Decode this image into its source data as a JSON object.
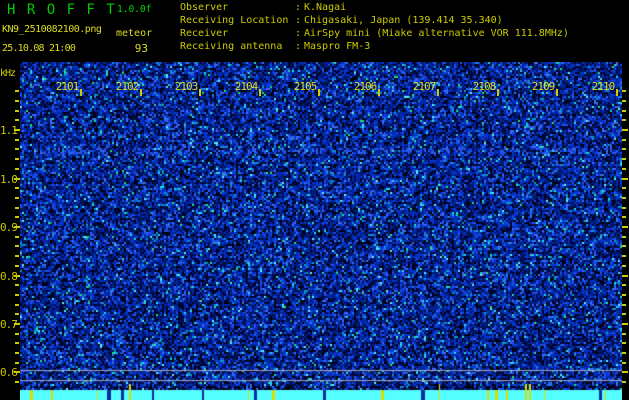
{
  "header": {
    "title": "H R O F F T",
    "version": "1.0.0f",
    "filename": "KN9_2510082100.png",
    "mode_label": "meteor",
    "meteor_count": "93",
    "datetime": "25.10.08 21:00",
    "separator": ":",
    "station_info": [
      {
        "label": "Observer",
        "value": "K.Nagai"
      },
      {
        "label": "Receiving Location",
        "value": "Chigasaki, Japan (139.414 35.340)"
      },
      {
        "label": "Receiver",
        "value": "AirSpy mini (Miake alternative VOR 111.8MHz)"
      },
      {
        "label": "Receiving antenna",
        "value": "Maspro FM-3"
      }
    ]
  },
  "chart_data": {
    "type": "heatmap",
    "title": "HROFFT radio meteor echo spectrogram (10 minutes)",
    "x_tick_labels": [
      "2101",
      "2102",
      "2103",
      "2104",
      "2105",
      "2106",
      "2107",
      "2108",
      "2109",
      "2110"
    ],
    "y_axis_unit": "kHz",
    "y_tick_labels": [
      "1.1",
      "1.0",
      "0.9",
      "0.8",
      "0.7",
      "0.6"
    ],
    "y_tick_values_khz": [
      1.1,
      1.0,
      0.9,
      0.8,
      0.7,
      0.6
    ],
    "y_range_khz": [
      0.56,
      1.24
    ],
    "horizontal_marker_lines_khz": [
      0.605,
      0.585
    ],
    "content_note": "uniform blue background noise, no meteor echo traces visible",
    "bottom_band_note": "cyan signal-level strip with scattered yellow event ticks"
  },
  "colors": {
    "background": "#000000",
    "title_green": "#00cc00",
    "text_yellow": "#cccc00",
    "label_yellow": "#dddd22",
    "band_cyan": "#55ffff",
    "bar_yellow": "#dddd00",
    "gap_blue": "#0a2f9e",
    "marker_line_gray": "#a0a4b8",
    "noise_palette": [
      {
        "color": "#000000",
        "w": 0.03
      },
      {
        "color": "#000022",
        "w": 0.14
      },
      {
        "color": "#000d44",
        "w": 0.16
      },
      {
        "color": "#001a77",
        "w": 0.15
      },
      {
        "color": "#0028aa",
        "w": 0.18
      },
      {
        "color": "#0736cf",
        "w": 0.14
      },
      {
        "color": "#1c4fe8",
        "w": 0.09
      },
      {
        "color": "#3a6cf5",
        "w": 0.05
      },
      {
        "color": "#0899cc",
        "w": 0.03
      },
      {
        "color": "#27d8e8",
        "w": 0.018
      },
      {
        "color": "#59f2ff",
        "w": 0.007
      },
      {
        "color": "#24e08a",
        "w": 0.005
      }
    ]
  }
}
